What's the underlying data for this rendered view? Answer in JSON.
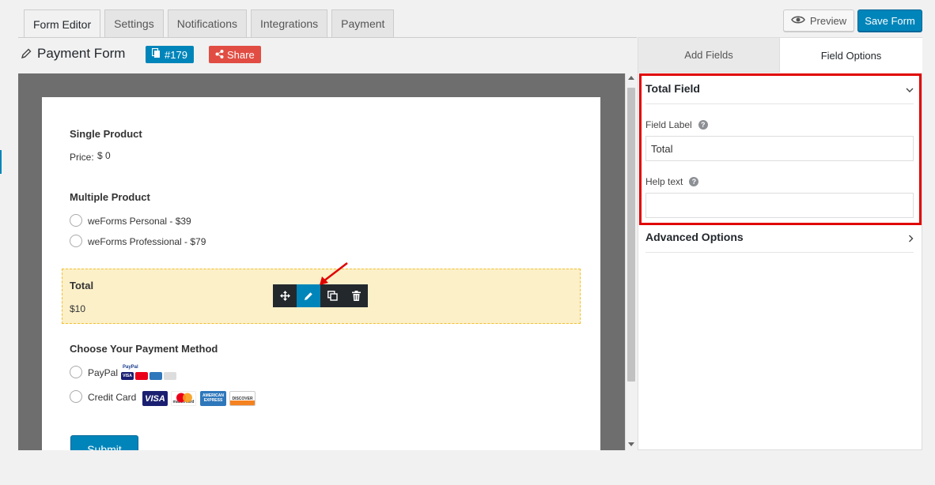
{
  "tabs": [
    {
      "label": "Form Editor",
      "active": true
    },
    {
      "label": "Settings"
    },
    {
      "label": "Notifications"
    },
    {
      "label": "Integrations"
    },
    {
      "label": "Payment"
    }
  ],
  "toolbar": {
    "preview_label": "Preview",
    "save_label": "Save Form"
  },
  "form": {
    "title": "Payment Form",
    "id_badge": "#179",
    "share_label": "Share"
  },
  "fields": {
    "single_product": {
      "label": "Single Product",
      "price_prefix": "Price:",
      "price_value": "$ 0"
    },
    "multiple_product": {
      "label": "Multiple Product",
      "options": [
        "weForms Personal - $39",
        "weForms Professional - $79"
      ]
    },
    "total": {
      "label": "Total",
      "value": "$10"
    },
    "payment_method": {
      "label": "Choose Your Payment Method",
      "options": [
        "PayPal",
        "Credit Card"
      ]
    },
    "cards": [
      "VISA",
      "mastercard",
      "AMERICAN EXPRESS",
      "DISCOVER"
    ],
    "submit_label": "Submit"
  },
  "panel": {
    "tabs": [
      {
        "label": "Add Fields"
      },
      {
        "label": "Field Options",
        "active": true
      }
    ],
    "section_title": "Total Field",
    "field_label_label": "Field Label",
    "field_label_value": "Total",
    "help_text_label": "Help text",
    "help_text_value": "",
    "advanced_label": "Advanced Options"
  },
  "colors": {
    "accent": "#0085ba",
    "share": "#e14d43",
    "highlight": "#e00000",
    "total_bg": "#fcf0c9"
  }
}
